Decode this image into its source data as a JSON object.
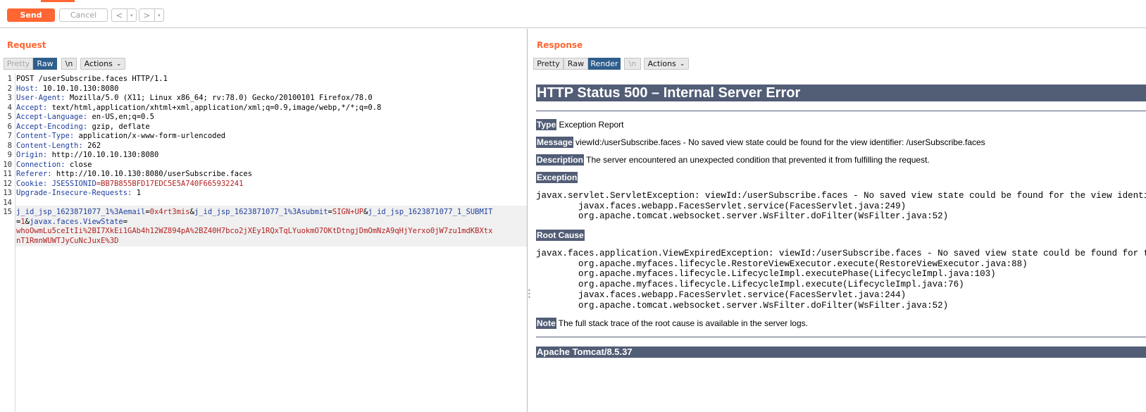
{
  "toolbar": {
    "send_label": "Send",
    "cancel_label": "Cancel",
    "back_arrow": "<",
    "forward_arrow": ">",
    "caret": "▾"
  },
  "request": {
    "title": "Request",
    "tabs": {
      "pretty": "Pretty",
      "raw": "Raw",
      "newline": "\\n",
      "actions": "Actions"
    },
    "lines": [
      {
        "n": "1",
        "text": "POST /userSubscribe.faces HTTP/1.1"
      },
      {
        "n": "2",
        "key": "Host:",
        "value": " 10.10.10.130:8080"
      },
      {
        "n": "3",
        "key": "User-Agent:",
        "value": " Mozilla/5.0 (X11; Linux x86_64; rv:78.0) Gecko/20100101 Firefox/78.0"
      },
      {
        "n": "4",
        "key": "Accept:",
        "value": " text/html,application/xhtml+xml,application/xml;q=0.9,image/webp,*/*;q=0.8"
      },
      {
        "n": "5",
        "key": "Accept-Language:",
        "value": " en-US,en;q=0.5"
      },
      {
        "n": "6",
        "key": "Accept-Encoding:",
        "value": " gzip, deflate"
      },
      {
        "n": "7",
        "key": "Content-Type:",
        "value": " application/x-www-form-urlencoded"
      },
      {
        "n": "8",
        "key": "Content-Length:",
        "value": " 262"
      },
      {
        "n": "9",
        "key": "Origin:",
        "value": " http://10.10.10.130:8080"
      },
      {
        "n": "10",
        "key": "Connection:",
        "value": " close"
      },
      {
        "n": "11",
        "key": "Referer:",
        "value": " http://10.10.10.130:8080/userSubscribe.faces"
      },
      {
        "n": "12",
        "key": "Cookie:",
        "cookie_name": " JSESSIONID",
        "cookie_value": "=BB7B855BFD17EDC5E5A740F665932241"
      },
      {
        "n": "13",
        "key": "Upgrade-Insecure-Requests:",
        "value": " 1"
      },
      {
        "n": "14",
        "text": ""
      }
    ],
    "body_line_number": "15",
    "body": {
      "p1_name": "j_id_jsp_1623871077_1%3Aemail",
      "p1_value": "0x4rt3mis",
      "p2_name": "j_id_jsp_1623871077_1%3Asubmit",
      "p2_value": "SIGN+UP",
      "p3_name": "j_id_jsp_1623871077_1_SUBMIT",
      "p3_value": "1",
      "p4_name": "javax.faces.ViewState",
      "viewstate_1": "whoOwmLu5ceItIi%2BI7XkEi1GAb4h12WZ894pA%2BZ40H7bco2jXEy1RQxTqLYuokmO7OKtDtngjDmOmNzA9qHjYerxo0jW7zu1mdKBXtx",
      "viewstate_2": "nT1RmnWUWTJyCuNcJuxE%3D"
    }
  },
  "response": {
    "title": "Response",
    "tabs": {
      "pretty": "Pretty",
      "raw": "Raw",
      "render": "Render",
      "newline": "\\n",
      "actions": "Actions"
    },
    "heading": "HTTP Status 500 – Internal Server Error",
    "type_label": "Type",
    "type_text": " Exception Report",
    "message_label": "Message",
    "message_text": " viewId:/userSubscribe.faces - No saved view state could be found for the view identifier: /userSubscribe.faces",
    "description_label": "Description",
    "description_text": " The server encountered an unexpected condition that prevented it from fulfilling the request.",
    "exception_label": "Exception",
    "exception_trace": "javax.servlet.ServletException: viewId:/userSubscribe.faces - No saved view state could be found for the view identifier: /userSubscribe.faces\n        javax.faces.webapp.FacesServlet.service(FacesServlet.java:249)\n        org.apache.tomcat.websocket.server.WsFilter.doFilter(WsFilter.java:52)",
    "root_cause_label": "Root Cause",
    "root_cause_trace": "javax.faces.application.ViewExpiredException: viewId:/userSubscribe.faces - No saved view state could be found for the view identifier: /userSubscribe.faces\n        org.apache.myfaces.lifecycle.RestoreViewExecutor.execute(RestoreViewExecutor.java:88)\n        org.apache.myfaces.lifecycle.LifecycleImpl.executePhase(LifecycleImpl.java:103)\n        org.apache.myfaces.lifecycle.LifecycleImpl.execute(LifecycleImpl.java:76)\n        javax.faces.webapp.FacesServlet.service(FacesServlet.java:244)\n        org.apache.tomcat.websocket.server.WsFilter.doFilter(WsFilter.java:52)",
    "note_label": "Note",
    "note_text": " The full stack trace of the root cause is available in the server logs.",
    "footer": "Apache Tomcat/8.5.37"
  },
  "colors": {
    "accent": "#ff6633",
    "tab_active": "#2e5e8c",
    "tomcat_header": "#525d76",
    "header_key": "#1f3f9e",
    "param_value": "#b32020"
  }
}
